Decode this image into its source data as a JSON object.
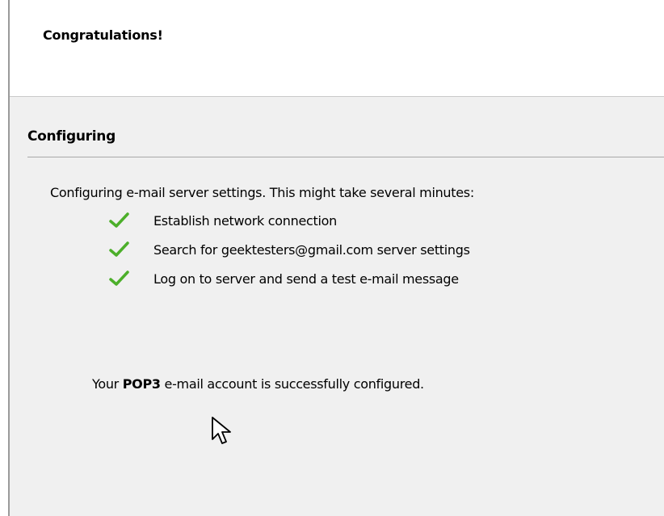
{
  "header": {
    "title": "Congratulations!"
  },
  "section": {
    "title": "Configuring"
  },
  "intro": "Configuring e-mail server settings. This might take several minutes:",
  "steps": [
    {
      "label": "Establish network connection",
      "status": "check-icon"
    },
    {
      "label": "Search for geektesters@gmail.com server settings",
      "status": "check-icon"
    },
    {
      "label": "Log on to server and send a test e-mail message",
      "status": "check-icon"
    }
  ],
  "result": {
    "prefix": "Your ",
    "account_type": "POP3",
    "suffix": " e-mail account is successfully configured."
  },
  "colors": {
    "check": "#4caf2a",
    "background": "#f0f0f0",
    "header_background": "#ffffff"
  }
}
